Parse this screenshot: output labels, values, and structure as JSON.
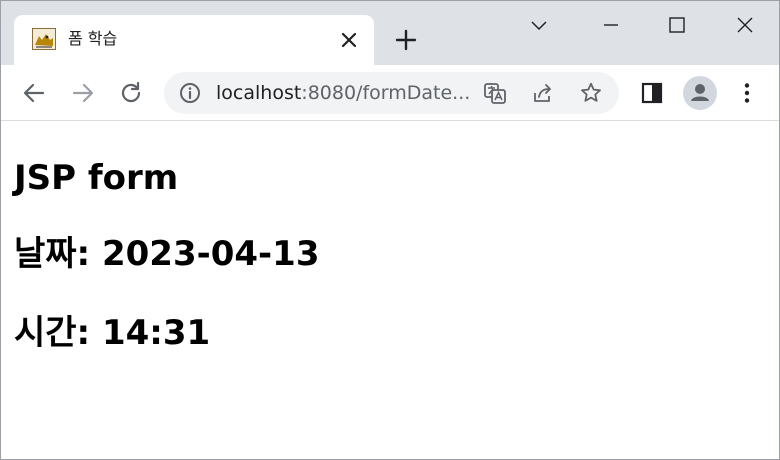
{
  "tab": {
    "title": "폼 학습"
  },
  "address_bar": {
    "url_host": "localhost",
    "url_rest": ":8080/formDate..."
  },
  "page": {
    "heading": "JSP form",
    "date_line": "날짜: 2023-04-13",
    "time_line": "시간: 14:31"
  },
  "icons": {
    "favicon": "tomcat-icon",
    "close": "close-icon",
    "new_tab": "plus-icon",
    "minimize": "minimize-icon",
    "maximize": "maximize-icon",
    "window_close": "close-icon",
    "back": "arrow-left-icon",
    "forward": "arrow-right-icon",
    "reload": "reload-icon",
    "info": "info-icon",
    "translate": "translate-icon",
    "share": "share-icon",
    "bookmark": "star-icon",
    "sidepanel": "side-panel-icon",
    "profile": "avatar-icon",
    "menu": "kebab-menu-icon"
  },
  "colors": {
    "tabstrip": "#dee1e6",
    "omnibox": "#f1f3f4",
    "icon": "#5f6368",
    "disabled_icon": "#9aa0a6"
  }
}
